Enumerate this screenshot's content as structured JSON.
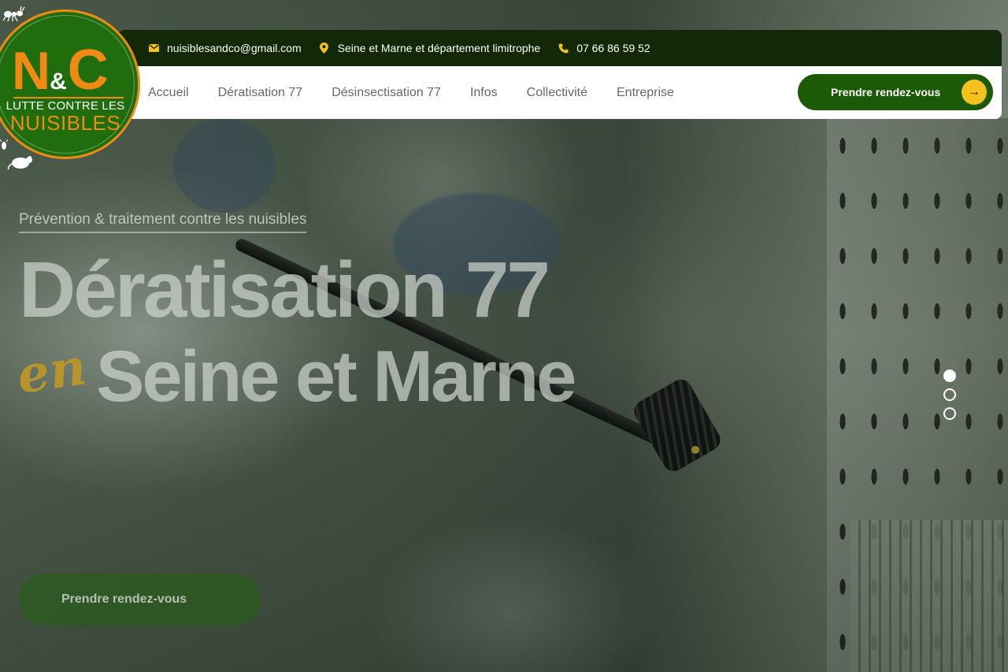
{
  "brand": {
    "logo_letter_n": "N",
    "logo_ampersand": "&",
    "logo_letter_c": "C",
    "logo_line1": "LUTTE CONTRE LES",
    "logo_line2": "NUISIBLES",
    "colors": {
      "primary_green": "#1c5a08",
      "dark_green": "#122807",
      "orange": "#f18a12",
      "yellow": "#f3c21d"
    }
  },
  "topbar": {
    "email_icon": "envelope-icon",
    "email": "nuisiblesandco@gmail.com",
    "location_icon": "map-pin-icon",
    "location": "Seine et Marne et département limitrophe",
    "phone_icon": "phone-icon",
    "phone": "07 66 86 59 52"
  },
  "nav": {
    "items": [
      {
        "label": "Accueil"
      },
      {
        "label": "Dératisation 77"
      },
      {
        "label": "Désinsectisation 77"
      },
      {
        "label": "Infos"
      },
      {
        "label": "Collectivité"
      },
      {
        "label": "Entreprise"
      }
    ],
    "cta_label": "Prendre rendez-vous",
    "cta_icon": "arrow-right-icon"
  },
  "hero": {
    "eyebrow": "Prévention & traitement contre les nuisibles",
    "title_line1": "Dératisation 77",
    "script_word": "en",
    "title_line2": "Seine et Marne",
    "cta_label": "Prendre rendez-vous"
  },
  "slider": {
    "slide_count": 3,
    "active_index": 0
  }
}
